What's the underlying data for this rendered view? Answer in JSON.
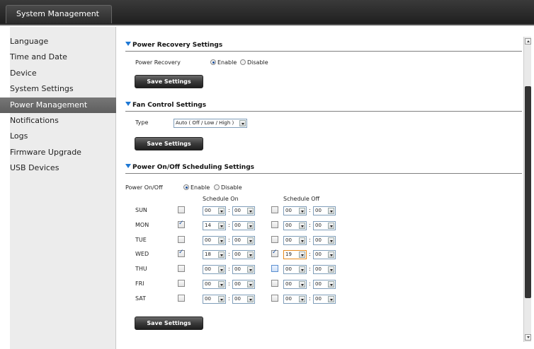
{
  "header": {
    "tab_label": "System Management"
  },
  "sidebar": {
    "items": [
      {
        "label": "Language"
      },
      {
        "label": "Time and Date"
      },
      {
        "label": "Device"
      },
      {
        "label": "System Settings"
      },
      {
        "label": "Power Management",
        "active": true
      },
      {
        "label": "Notifications"
      },
      {
        "label": "Logs"
      },
      {
        "label": "Firmware Upgrade"
      },
      {
        "label": "USB Devices"
      }
    ]
  },
  "power_recovery": {
    "title": "Power Recovery Settings",
    "field_label": "Power Recovery",
    "enable_label": "Enable",
    "disable_label": "Disable",
    "selected": "Enable",
    "save_label": "Save Settings"
  },
  "fan_control": {
    "title": "Fan Control Settings",
    "type_label": "Type",
    "type_value": "Auto ( Off / Low / High )",
    "save_label": "Save Settings"
  },
  "scheduling": {
    "title": "Power On/Off Scheduling Settings",
    "field_label": "Power On/Off",
    "enable_label": "Enable",
    "disable_label": "Disable",
    "selected": "Enable",
    "schedule_on_label": "Schedule On",
    "schedule_off_label": "Schedule Off",
    "days": [
      {
        "day": "SUN",
        "on_checked": false,
        "on_hour": "00",
        "on_min": "00",
        "off_checked": false,
        "off_hour": "00",
        "off_min": "00"
      },
      {
        "day": "MON",
        "on_checked": true,
        "on_hour": "14",
        "on_min": "00",
        "off_checked": false,
        "off_hour": "00",
        "off_min": "00"
      },
      {
        "day": "TUE",
        "on_checked": false,
        "on_hour": "00",
        "on_min": "00",
        "off_checked": false,
        "off_hour": "00",
        "off_min": "00"
      },
      {
        "day": "WED",
        "on_checked": true,
        "on_hour": "18",
        "on_min": "00",
        "off_checked": true,
        "off_hour": "19",
        "off_min": "00"
      },
      {
        "day": "THU",
        "on_checked": false,
        "on_hour": "00",
        "on_min": "00",
        "off_checked": false,
        "off_hour": "00",
        "off_min": "00"
      },
      {
        "day": "FRI",
        "on_checked": false,
        "on_hour": "00",
        "on_min": "00",
        "off_checked": false,
        "off_hour": "00",
        "off_min": "00"
      },
      {
        "day": "SAT",
        "on_checked": false,
        "on_hour": "00",
        "on_min": "00",
        "off_checked": false,
        "off_hour": "00",
        "off_min": "00"
      }
    ],
    "colon": ":",
    "save_label": "Save Settings"
  },
  "colors": {
    "accent": "#1e78d4",
    "active_nav": "#6a6a6a",
    "header_bg": "#2a2a2a"
  }
}
